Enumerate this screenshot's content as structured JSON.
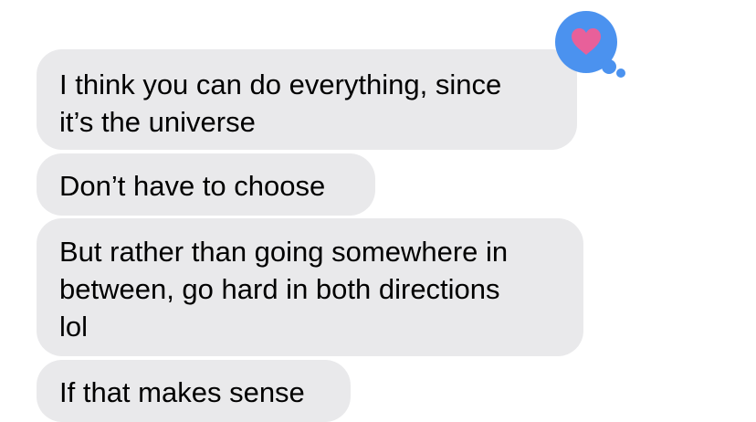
{
  "messages": [
    {
      "text": "I think you can do everything, since\nit’s the universe"
    },
    {
      "text": "Don’t have to choose"
    },
    {
      "text": "But rather than going somewhere in\nbetween, go hard in both directions\nlol"
    },
    {
      "text": "If that makes sense"
    }
  ],
  "reaction": {
    "icon": "heart-icon",
    "bubble_color": "#4b92ef",
    "heart_color": "#e8609a"
  },
  "bubble_color": "#e9e9eb"
}
